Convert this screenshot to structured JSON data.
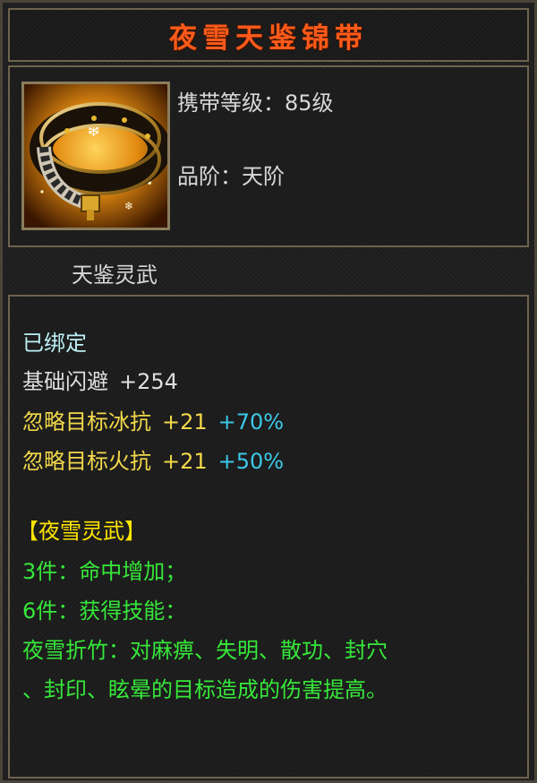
{
  "item": {
    "name": "夜雪天鉴锦带",
    "icon": "belt-icon",
    "level_label": "携带等级：",
    "level_value": "85级",
    "grade_label": "品阶：",
    "grade_value": "天阶",
    "set_name": "天鉴灵武"
  },
  "stats": {
    "bound": "已绑定",
    "base_dodge_label": "基础闪避",
    "base_dodge_value": "+254",
    "ice_label": "忽略目标冰抗",
    "ice_value": "+21",
    "ice_pct": "+70%",
    "fire_label": "忽略目标火抗",
    "fire_value": "+21",
    "fire_pct": "+50%"
  },
  "set_bonus": {
    "title": "【夜雪灵武】",
    "bonus3": "3件：命中增加；",
    "bonus6": "6件：获得技能：",
    "skill_line1": "夜雪折竹：对麻痹、失明、散功、封穴",
    "skill_line2": "、封印、眩晕的目标造成的伤害提高。"
  },
  "colors": {
    "title": "#ff5a1a",
    "bound": "#bdf0f5",
    "stat_yellow": "#f2d84a",
    "stat_blue": "#3cc8e8",
    "set_green": "#36e83a",
    "set_title": "#ffe600"
  }
}
